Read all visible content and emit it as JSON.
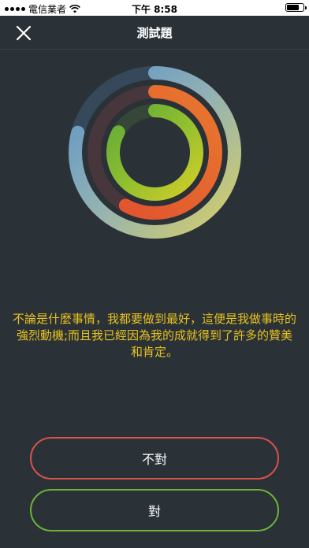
{
  "status_bar": {
    "carrier": "電信業者",
    "time": "下午 8:58",
    "wifi_icon": "wifi-icon",
    "battery_icon": "battery-icon"
  },
  "nav": {
    "title": "測試題",
    "close_icon": "close-icon"
  },
  "rings": {
    "outer": {
      "track_color": "#35495a",
      "gradient": [
        "#d8cf64",
        "#93b2b3",
        "#5a93c9"
      ],
      "fraction": 0.79
    },
    "middle": {
      "track_color": "#47363b",
      "gradient": [
        "#e36a33",
        "#e14f2d"
      ],
      "fraction": 0.58
    },
    "inner": {
      "track_color": "#364638",
      "gradient": [
        "#d2cd29",
        "#8fbf2e",
        "#62a93a"
      ],
      "fraction": 0.83
    }
  },
  "question": {
    "text": "不論是什麼事情，我都要做到最好，這便是我做事時的強烈動機;而且我已經因為我的成就得到了許多的贊美和肯定。"
  },
  "answers": {
    "false_label": "不對",
    "true_label": "對"
  },
  "colors": {
    "background": "#2b3237",
    "question_text": "#e7c21f",
    "false_border": "#d9524a",
    "true_border": "#6fb13a"
  }
}
